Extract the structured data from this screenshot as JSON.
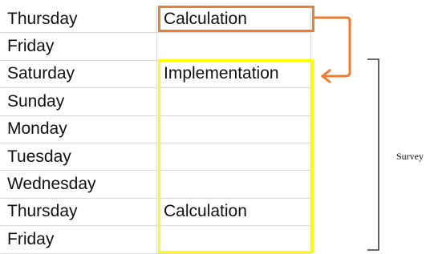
{
  "rows": [
    {
      "day": "Thursday",
      "task": "Calculation"
    },
    {
      "day": "Friday",
      "task": ""
    },
    {
      "day": "Saturday",
      "task": "Implementation"
    },
    {
      "day": "Sunday",
      "task": ""
    },
    {
      "day": "Monday",
      "task": ""
    },
    {
      "day": "Tuesday",
      "task": ""
    },
    {
      "day": "Wednesday",
      "task": ""
    },
    {
      "day": "Thursday",
      "task": "Calculation"
    },
    {
      "day": "Friday",
      "task": ""
    }
  ],
  "annotations": {
    "survey_label": "Survey",
    "orange_color": "#ed7d31",
    "yellow_color": "#ffff00",
    "arrow_icon": "curved-arrow-icon",
    "bracket_icon": "right-brace-icon"
  }
}
